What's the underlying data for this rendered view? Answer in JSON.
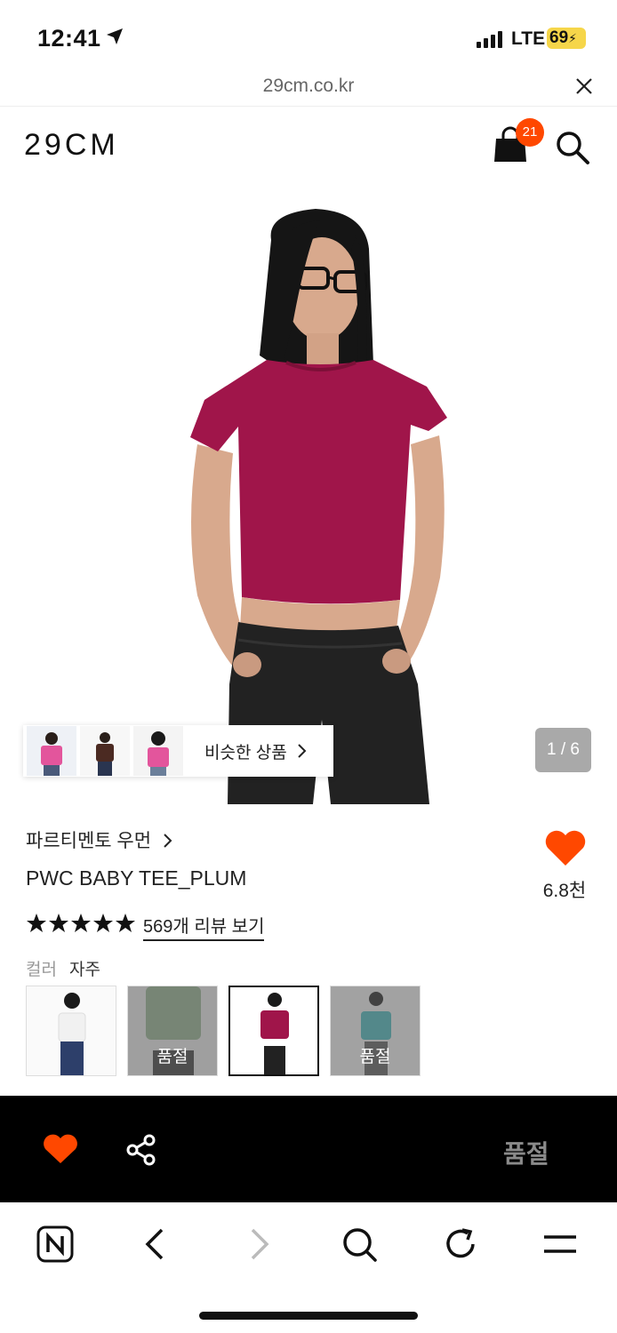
{
  "status_bar": {
    "time": "12:41",
    "network": "LTE",
    "battery": "69"
  },
  "url_bar": {
    "url": "29cm.co.kr"
  },
  "header": {
    "logo": "29CM",
    "cart_count": "21"
  },
  "gallery": {
    "similar_label": "비슷한 상품",
    "pager": "1 / 6"
  },
  "product": {
    "brand": "파르티멘토 우먼",
    "name": "PWC BABY TEE_PLUM",
    "like_count": "6.8천",
    "rating_stars": 5,
    "reviews_label": "569개 리뷰 보기",
    "color_label": "컬러",
    "color_value": "자주",
    "swatches": [
      {
        "color": "#f4f4f4",
        "sold_out": ""
      },
      {
        "color": "#8fae8a",
        "sold_out": "품절"
      },
      {
        "color": "#a11a4a",
        "sold_out": ""
      },
      {
        "color": "#3fb3b8",
        "sold_out": "품절"
      }
    ]
  },
  "action_bar": {
    "status_label": "품절"
  },
  "colors": {
    "accent": "#ff4800",
    "shirt": "#a0154a",
    "dark": "#000000"
  }
}
